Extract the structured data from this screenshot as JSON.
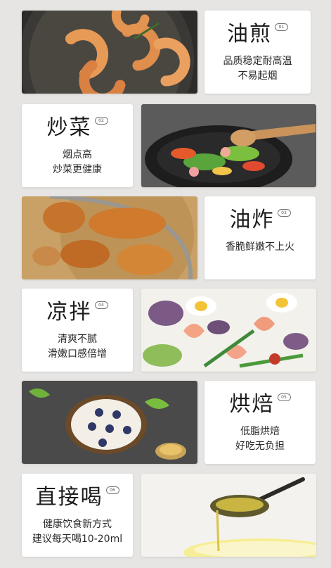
{
  "rows": [
    {
      "title": "油煎",
      "num": "01",
      "lines": [
        "品质稳定耐高温",
        "不易起烟"
      ],
      "photo_icon": "fried-shrimp-pan-icon"
    },
    {
      "title": "炒菜",
      "num": "02",
      "lines": [
        "烟点高",
        "炒菜更健康"
      ],
      "photo_icon": "stir-fry-wok-icon"
    },
    {
      "title": "油炸",
      "num": "03",
      "lines": [
        "香脆鲜嫩不上火"
      ],
      "photo_icon": "fried-chicken-icon"
    },
    {
      "title": "凉拌",
      "num": "04",
      "lines": [
        "清爽不腻",
        "滑嫩口感倍增"
      ],
      "photo_icon": "salad-icon"
    },
    {
      "title": "烘焙",
      "num": "05",
      "lines": [
        "低脂烘焙",
        "好吃无负担"
      ],
      "photo_icon": "bread-toast-icon"
    },
    {
      "title": "直接喝",
      "num": "06",
      "lines": [
        "健康饮食新方式",
        "建议每天喝10-20ml"
      ],
      "photo_icon": "oil-spoon-icon"
    }
  ],
  "colors": {
    "background": "#e6e5e3",
    "card": "#ffffff",
    "text": "#1c1c1c"
  }
}
